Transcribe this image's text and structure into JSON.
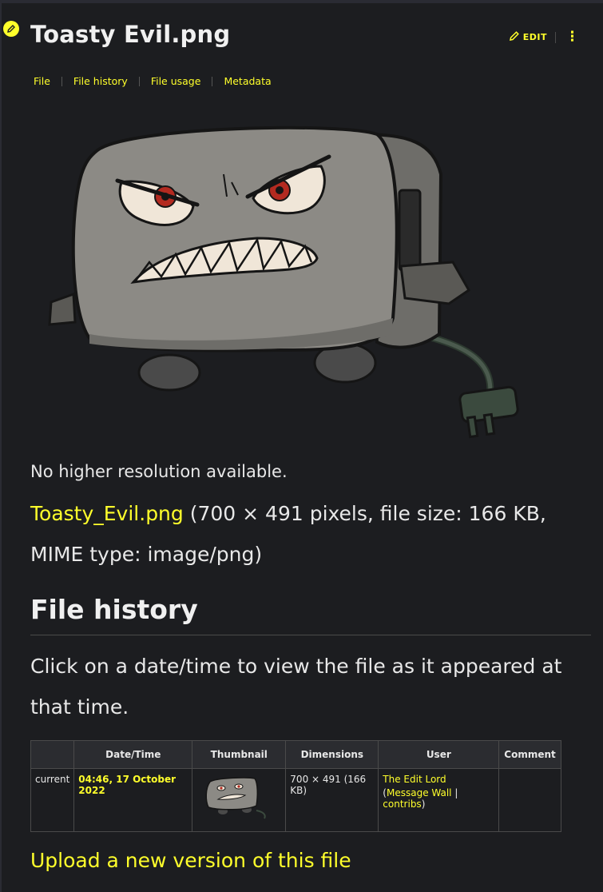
{
  "page": {
    "title": "Toasty Evil.png",
    "edit_label": "EDIT"
  },
  "tabs": [
    "File",
    "File history",
    "File usage",
    "Metadata"
  ],
  "file_info": {
    "no_higher": "No higher resolution available.",
    "file_link": "Toasty_Evil.png",
    "details": " (700 × 491 pixels, file size: 166 KB, MIME type: image/png)"
  },
  "history": {
    "heading": "File history",
    "note": "Click on a date/time to view the file as it appeared at that time.",
    "columns": [
      "",
      "Date/Time",
      "Thumbnail",
      "Dimensions",
      "User",
      "Comment"
    ],
    "rows": [
      {
        "status": "current",
        "datetime": "04:46, 17 October 2022",
        "dimensions": "700 × 491 (166 KB)",
        "user": "The Edit Lord",
        "open_paren": "(",
        "message_wall": "Message Wall",
        "pipe": " | ",
        "contribs": "contribs",
        "close_paren": ")",
        "comment": ""
      }
    ]
  },
  "upload_label": "Upload a new version of this file",
  "colors": {
    "accent": "#ffff2b",
    "background": "#1c1d20"
  },
  "icons": {
    "edit": "pencil-icon",
    "more": "kebab-menu-icon"
  }
}
